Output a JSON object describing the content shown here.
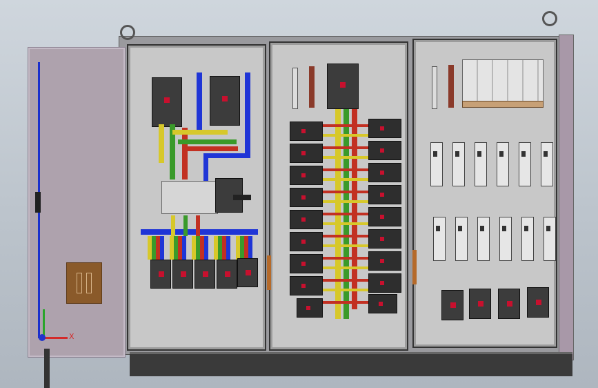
{
  "scene": {
    "axis": {
      "x_label": "X"
    },
    "icons": [
      "eyebolt-icon",
      "axis-triad-icon",
      "circuit-breaker-icon",
      "busbar-icon",
      "terminal-strip-icon",
      "relay-icon"
    ]
  }
}
